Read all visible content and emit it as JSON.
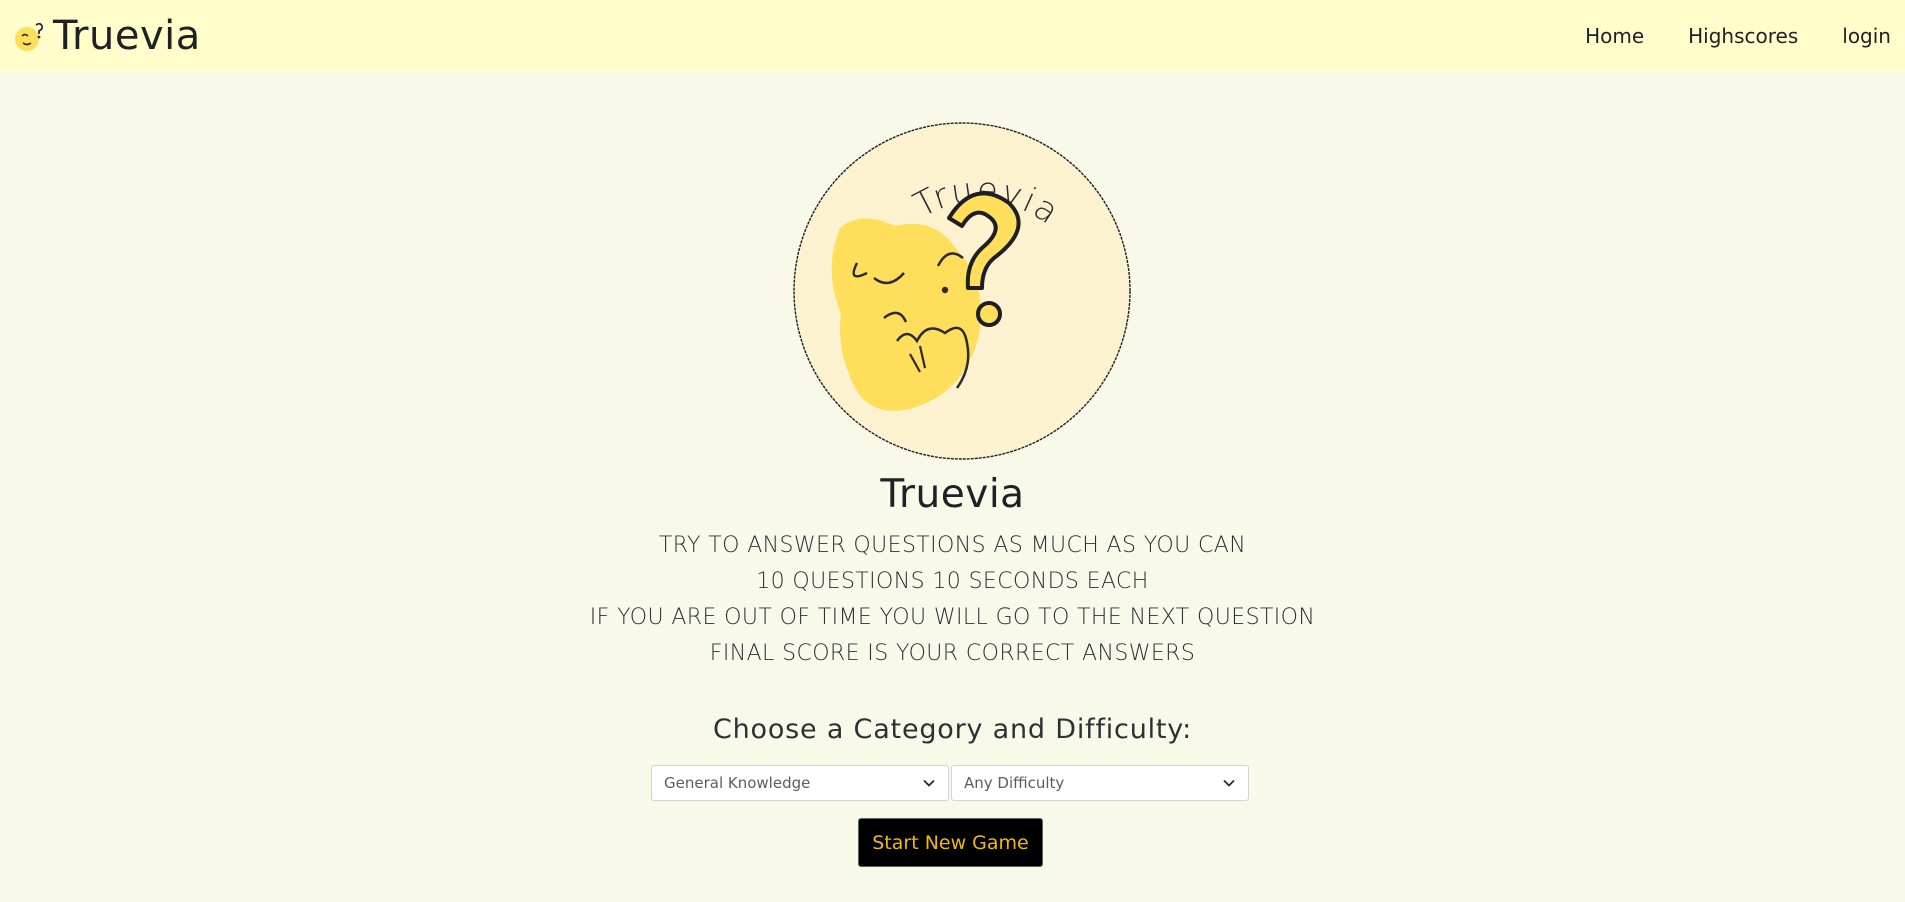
{
  "nav": {
    "brand": "Truevia",
    "links": [
      "Home",
      "Highscores",
      "login"
    ]
  },
  "logo": {
    "text": "Truevia"
  },
  "main": {
    "title": "Truevia",
    "rules": [
      "TRY TO ANSWER QUESTIONS AS MUCH AS YOU CAN",
      "10 QUESTIONS 10 SECONDS EACH",
      "IF YOU ARE OUT OF TIME YOU WILL GO TO THE NEXT QUESTION",
      "FINAL SCORE IS YOUR CORRECT ANSWERS"
    ],
    "choose_label": "Choose a Category and Difficulty:",
    "category_select": {
      "value": "General Knowledge"
    },
    "difficulty_select": {
      "value": "Any Difficulty"
    },
    "start_button": "Start New Game"
  },
  "colors": {
    "page_bg": "#f9f9e9",
    "navbar_bg": "#fffdc9",
    "button_bg": "#000000",
    "button_text": "#f0b90b",
    "face_yellow": "#fede5a"
  },
  "icons": {
    "brand": "thinking-face-icon",
    "select_arrow": "chevron-down-icon"
  }
}
